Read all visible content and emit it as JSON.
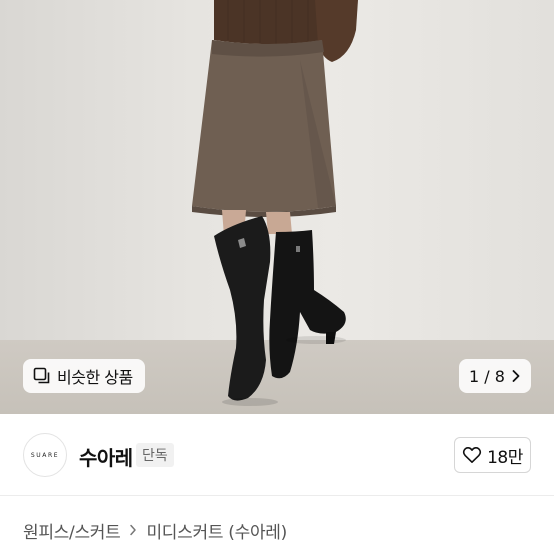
{
  "gallery": {
    "similar_label": "비슷한 상품",
    "pager_text": "1 / 8",
    "icons": {
      "similar": "copy-icon",
      "next": "chevron-right-icon"
    }
  },
  "shop": {
    "logo_text": "SUARE",
    "name": "수아레",
    "badge": "단독",
    "like_count": "18만",
    "icons": {
      "like": "heart-icon"
    }
  },
  "breadcrumb": {
    "level1": "원피스/스커트",
    "level2": "미디스커트 (수아레)",
    "icons": {
      "separator": "chevron-right-icon"
    }
  }
}
